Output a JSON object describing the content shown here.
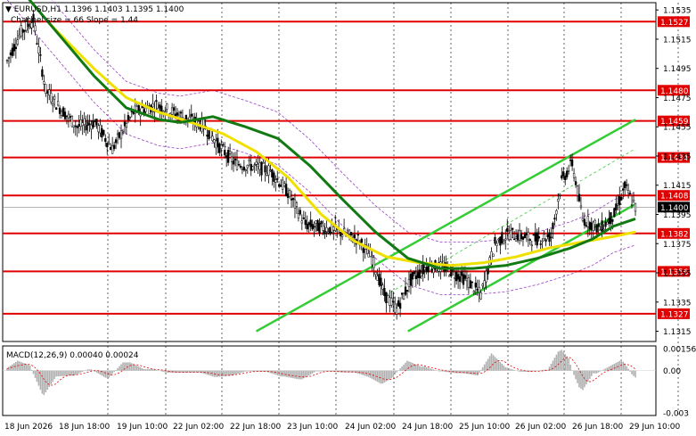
{
  "header": {
    "symbol_line": "EURUSD,H1  1.1396 1.1403 1.1395 1.1400",
    "channel_line": "Channel size = 66 Slope = 1.44"
  },
  "macd": {
    "label": "MACD(12,26,9) 0.00040 0.00024",
    "axis_ticks": [
      "0.00156",
      "0.00",
      "-0.003"
    ]
  },
  "price_axis_ticks": [
    "1.1535",
    "1.1515",
    "1.1495",
    "1.1475",
    "1.1455",
    "1.1435",
    "1.1415",
    "1.1395",
    "1.1375",
    "1.1355",
    "1.1335",
    "1.1315"
  ],
  "x_axis_labels": [
    "18 Jun 2026",
    "18 Jun 18:00",
    "19 Jun 10:00",
    "22 Jun 02:00",
    "22 Jun 18:00",
    "23 Jun 10:00",
    "24 Jun 02:00",
    "24 Jun 18:00",
    "25 Jun 10:00",
    "26 Jun 02:00",
    "26 Jun 18:00",
    "29 Jun 10:00"
  ],
  "levels": [
    {
      "price": 1.1527,
      "label": "1.1527",
      "color": "#e00000"
    },
    {
      "price": 1.148,
      "label": "1.1480",
      "color": "#e00000"
    },
    {
      "price": 1.1459,
      "label": "1.1459",
      "color": "#e00000"
    },
    {
      "price": 1.1434,
      "label": "1.1434",
      "color": "#e00000"
    },
    {
      "price": 1.1408,
      "label": "1.1408",
      "color": "#e00000"
    },
    {
      "price": 1.1382,
      "label": "1.1382",
      "color": "#e00000"
    },
    {
      "price": 1.1356,
      "label": "1.1356",
      "color": "#e00000"
    },
    {
      "price": 1.1327,
      "label": "1.1327",
      "color": "#e00000"
    }
  ],
  "current_price": {
    "price": 1.14,
    "label": "1.1400",
    "color": "#000000"
  },
  "colors": {
    "level": "#e00000",
    "channel": "#33cc33",
    "ma_fast": "#127a12",
    "ma_slow": "#f0e000",
    "envelope": "#9b3fc7",
    "candle": "#000000",
    "macd_hist": "#b0b0b0",
    "macd_signal": "#e00000"
  },
  "chart_data": {
    "type": "candlestick",
    "symbol": "EURUSD",
    "timeframe": "H1",
    "last": {
      "open": 1.1396,
      "high": 1.1403,
      "low": 1.1395,
      "close": 1.14
    },
    "ylim": [
      1.1308,
      1.154
    ],
    "ma_fast_path": [
      [
        0,
        1.156
      ],
      [
        20,
        1.1525
      ],
      [
        40,
        1.149
      ],
      [
        55,
        1.1468
      ],
      [
        70,
        1.146
      ],
      [
        80,
        1.1458
      ],
      [
        95,
        1.1462
      ],
      [
        110,
        1.1455
      ],
      [
        125,
        1.1447
      ],
      [
        140,
        1.1428
      ],
      [
        155,
        1.1405
      ],
      [
        170,
        1.1383
      ],
      [
        185,
        1.1365
      ],
      [
        200,
        1.1358
      ],
      [
        215,
        1.1358
      ],
      [
        230,
        1.136
      ],
      [
        245,
        1.1365
      ],
      [
        260,
        1.1372
      ],
      [
        270,
        1.1378
      ],
      [
        280,
        1.1387
      ],
      [
        290,
        1.1392
      ]
    ],
    "ma_slow_path": [
      [
        20,
        1.1525
      ],
      [
        40,
        1.1495
      ],
      [
        55,
        1.1475
      ],
      [
        70,
        1.1465
      ],
      [
        85,
        1.1458
      ],
      [
        100,
        1.145
      ],
      [
        115,
        1.1438
      ],
      [
        130,
        1.142
      ],
      [
        145,
        1.1395
      ],
      [
        160,
        1.1377
      ],
      [
        175,
        1.1366
      ],
      [
        190,
        1.1362
      ],
      [
        205,
        1.136
      ],
      [
        220,
        1.1362
      ],
      [
        235,
        1.1366
      ],
      [
        250,
        1.1372
      ],
      [
        265,
        1.1376
      ],
      [
        280,
        1.138
      ],
      [
        290,
        1.1383
      ]
    ],
    "channel_lower": [
      [
        115,
        1.1315
      ],
      [
        290,
        1.146
      ]
    ],
    "channel_upper": [
      [
        185,
        1.1315
      ],
      [
        290,
        1.1402
      ]
    ],
    "channel_mid": [
      [
        175,
        1.134
      ],
      [
        290,
        1.144
      ]
    ],
    "macd_range": [
      -0.003,
      0.00156
    ],
    "macd_last": {
      "macd": 0.0004,
      "signal": 0.00024
    }
  }
}
